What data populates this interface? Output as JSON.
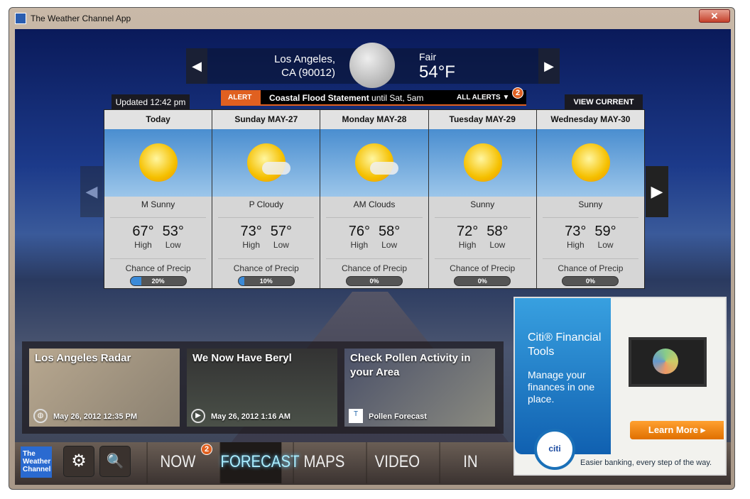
{
  "window": {
    "title": "The Weather Channel App",
    "close_label": "✕"
  },
  "location": {
    "city": "Los Angeles,",
    "region": "CA (90012)",
    "condition": "Fair",
    "temperature": "54°F",
    "prev_icon": "◀",
    "next_icon": "▶"
  },
  "updated": "Updated 12:42 pm",
  "alert": {
    "tag": "ALERT",
    "title": "Coastal Flood Statement",
    "detail": " until Sat, 5am",
    "all_alerts": "ALL ALERTS ▼",
    "count": "2"
  },
  "view_current": "VIEW CURRENT",
  "forecast": [
    {
      "day": "Today",
      "icon": "sun",
      "desc": "M Sunny",
      "high": "67°",
      "low": "53°",
      "precip": 20,
      "precip_label": "20%"
    },
    {
      "day": "Sunday MAY-27",
      "icon": "sun-cloud",
      "desc": "P Cloudy",
      "high": "73°",
      "low": "57°",
      "precip": 10,
      "precip_label": "10%"
    },
    {
      "day": "Monday MAY-28",
      "icon": "sun-cloud",
      "desc": "AM Clouds",
      "high": "76°",
      "low": "58°",
      "precip": 0,
      "precip_label": "0%"
    },
    {
      "day": "Tuesday MAY-29",
      "icon": "sun",
      "desc": "Sunny",
      "high": "72°",
      "low": "58°",
      "precip": 0,
      "precip_label": "0%"
    },
    {
      "day": "Wednesday MAY-30",
      "icon": "sun",
      "desc": "Sunny",
      "high": "73°",
      "low": "59°",
      "precip": 0,
      "precip_label": "0%"
    }
  ],
  "labels": {
    "high": "High",
    "low": "Low",
    "chance": "Chance of Precip",
    "prev": "◀",
    "next": "▶"
  },
  "tiles": [
    {
      "title": "Los Angeles Radar",
      "footer": "May 26, 2012 12:35 PM",
      "icon": "globe-icon"
    },
    {
      "title": "We Now Have  Beryl",
      "footer": "May 26, 2012 1:16 AM",
      "icon": "play-icon"
    },
    {
      "title": "Check Pollen Activity in your Area",
      "footer": "Pollen Forecast",
      "icon": "twc-logo"
    }
  ],
  "nav": {
    "logo": "The Weather Channel",
    "settings": "⚙",
    "search": "🔍",
    "tabs": [
      "NOW",
      "FORECAST",
      "MAPS",
      "VIDEO",
      "IN SEASON"
    ],
    "active": "FORECAST",
    "now_badge": "2"
  },
  "ad": {
    "title": "Citi® Financial Tools",
    "body": "Manage your finances in one place.",
    "button": "Learn More ▸",
    "brand": "citi",
    "tagline": "Easier banking, every step of the way."
  },
  "colors": {
    "alert": "#e06020",
    "active_tab": "#aaeeff",
    "ad_blue": "#1a70b8",
    "ad_button": "#f08a10"
  }
}
